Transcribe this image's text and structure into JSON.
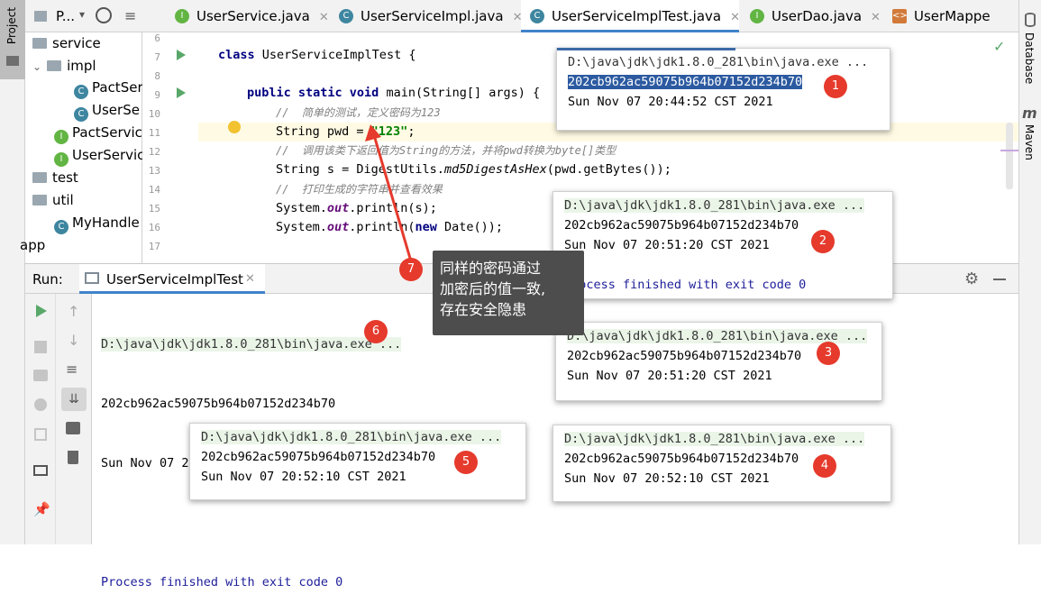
{
  "left_strip": {
    "project_label": "Project"
  },
  "project_pane": {
    "header_label": "P...",
    "tree": [
      {
        "label": "service",
        "kind": "folder"
      },
      {
        "label": "impl",
        "kind": "folder"
      },
      {
        "label": "PactSer",
        "kind": "class"
      },
      {
        "label": "UserSe",
        "kind": "class"
      },
      {
        "label": "PactServic",
        "kind": "interface"
      },
      {
        "label": "UserServic",
        "kind": "interface"
      },
      {
        "label": "test",
        "kind": "folder"
      },
      {
        "label": "util",
        "kind": "folder"
      },
      {
        "label": "MyHandle",
        "kind": "class"
      },
      {
        "label": "app",
        "kind": "text"
      }
    ]
  },
  "tabs": [
    {
      "label": "UserService.java",
      "icon": "interface-icon",
      "active": false
    },
    {
      "label": "UserServiceImpl.java",
      "icon": "class-icon",
      "active": false
    },
    {
      "label": "UserServiceImplTest.java",
      "icon": "runnable-class-icon",
      "active": true
    },
    {
      "label": "UserDao.java",
      "icon": "interface-icon",
      "active": false
    },
    {
      "label": "UserMappe",
      "icon": "xml-icon",
      "active": false
    }
  ],
  "right_strip": {
    "database_label": "Database",
    "maven_label": "Maven"
  },
  "editor": {
    "line_numbers": [
      "6",
      "7",
      "8",
      "9",
      "10",
      "11",
      "12",
      "13",
      "14",
      "15",
      "16",
      "17"
    ],
    "line7": {
      "kw": "class",
      "rest": " UserServiceImplTest {"
    },
    "line9": {
      "kw1": "public static void",
      "rest": " main(String[] args) {"
    },
    "line10": "//  简单的测试，定义密码为123",
    "line11": {
      "a": "String pwd = ",
      "str": "\"123\"",
      "b": ";"
    },
    "line12": "//  调用该类下返回值为String的方法，并将pwd转换为byte[]类型",
    "line13": {
      "a": "String s = DigestUtils.",
      "mi": "md5DigestAsHex",
      "b": "(pwd.getBytes());"
    },
    "line14": "//  打印生成的字符串并查看效果",
    "line15": {
      "a": "System.",
      "st": "out",
      "b": ".println(s);"
    },
    "line16": {
      "a": "System.",
      "st": "out",
      "b": ".println(",
      "kw": "new",
      "c": " Date());"
    }
  },
  "run_panel": {
    "run_label": "Run:",
    "tab_label": "UserServiceImplTest",
    "console": {
      "path": "D:\\java\\jdk\\jdk1.8.0_281\\bin\\java.exe ...",
      "hash": "202cb962ac59075b964b07152d234b70",
      "date": "Sun Nov 07 20:53:14 CST 2021",
      "exit": "Process finished with exit code 0",
      "badge": "6"
    }
  },
  "overlays": [
    {
      "badge": "1",
      "path": "D:\\java\\jdk\\jdk1.8.0_281\\bin\\java.exe ...",
      "hash": "202cb962ac59075b964b07152d234b70",
      "date": "Sun Nov 07 20:44:52 CST 2021"
    },
    {
      "badge": "2",
      "path": "D:\\java\\jdk\\jdk1.8.0_281\\bin\\java.exe ...",
      "hash": "202cb962ac59075b964b07152d234b70",
      "date": "Sun Nov 07 20:51:20 CST 2021",
      "exit": "Process finished with exit code 0"
    },
    {
      "badge": "3",
      "path": "D:\\java\\jdk\\jdk1.8.0_281\\bin\\java.exe ...",
      "hash": "202cb962ac59075b964b07152d234b70",
      "date": "Sun Nov 07 20:51:20 CST 2021"
    },
    {
      "badge": "4",
      "path": "D:\\java\\jdk\\jdk1.8.0_281\\bin\\java.exe ...",
      "hash": "202cb962ac59075b964b07152d234b70",
      "date": "Sun Nov 07 20:52:10 CST 2021"
    },
    {
      "badge": "5",
      "path": "D:\\java\\jdk\\jdk1.8.0_281\\bin\\java.exe ...",
      "hash": "202cb962ac59075b964b07152d234b70",
      "date": "Sun Nov 07 20:52:10 CST 2021"
    }
  ],
  "annotation": {
    "badge": "7",
    "lines": [
      "同样的密码通过",
      "加密后的值一致,",
      "存在安全隐患"
    ]
  },
  "colors": {
    "accent": "#4083c9",
    "badge": "#e53a2c",
    "path_bg": "#eaf5e8",
    "run_green": "#59a869"
  }
}
